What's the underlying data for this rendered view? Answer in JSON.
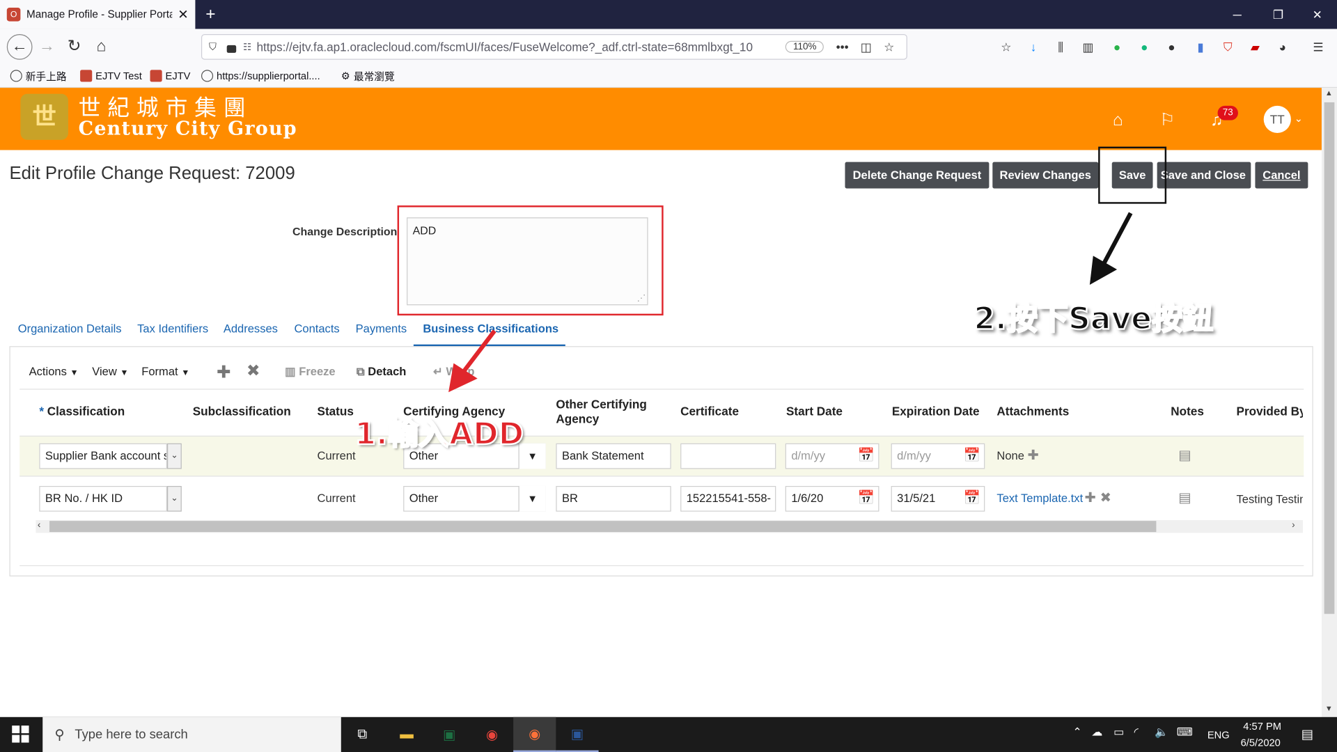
{
  "browser": {
    "tab_title": "Manage Profile - Supplier Porta",
    "tab_favicon": "O",
    "url": "https://ejtv.fa.ap1.oraclecloud.com/fscmUI/faces/FuseWelcome?_adf.ctrl-state=68mmlbxgt_10",
    "zoom": "110%",
    "bookmarks": [
      "新手上路",
      "EJTV Test",
      "EJTV",
      "https://supplierportal....",
      "最常瀏覽"
    ]
  },
  "header": {
    "logo_emblem": "世",
    "logo_cn": "世紀城市集團",
    "logo_en": "Century City Group",
    "notification_count": "73",
    "avatar_initials": "TT",
    "brand_color": "#ff8c00"
  },
  "page": {
    "title": "Edit Profile Change Request: 72009",
    "buttons": {
      "delete": "Delete Change Request",
      "review": "Review Changes",
      "save": "Save",
      "save_close": "Save and Close",
      "cancel": "Cancel"
    },
    "change_description_label": "Change Description",
    "change_description_value": "ADD"
  },
  "tabs": [
    "Organization Details",
    "Tax Identifiers",
    "Addresses",
    "Contacts",
    "Payments",
    "Business Classifications"
  ],
  "toolbar": {
    "actions": "Actions",
    "view": "View",
    "format": "Format",
    "freeze": "Freeze",
    "detach": "Detach",
    "wrap": "Wrap"
  },
  "table": {
    "required_mark": "*",
    "headers": {
      "classification": "Classification",
      "subclassification": "Subclassification",
      "status": "Status",
      "certifying_agency": "Certifying Agency",
      "other_certifying_1": "Other Certifying",
      "other_certifying_2": "Agency",
      "certificate": "Certificate",
      "start_date": "Start Date",
      "expiration_date": "Expiration Date",
      "attachments": "Attachments",
      "notes": "Notes",
      "provided_by": "Provided By"
    },
    "rows": [
      {
        "classification": "Supplier Bank account s",
        "status": "Current",
        "certifying_agency": "Other",
        "other_agency": "Bank Statement",
        "certificate": "",
        "start_date_placeholder": "d/m/yy",
        "expiration_placeholder": "d/m/yy",
        "attachments": "None",
        "provided_by": ""
      },
      {
        "classification": "BR No. / HK ID",
        "status": "Current",
        "certifying_agency": "Other",
        "other_agency": "BR",
        "certificate": "152215541-558-",
        "start_date": "1/6/20",
        "expiration_date": "31/5/21",
        "attachments": "Text Template.txt",
        "provided_by": "Testing Testin"
      }
    ]
  },
  "annotations": {
    "step1": "1.輸入ADD",
    "step2": "2.按下Save按鈕"
  },
  "taskbar": {
    "search_placeholder": "Type here to search",
    "lang": "ENG",
    "time": "4:57 PM",
    "date": "6/5/2020"
  }
}
